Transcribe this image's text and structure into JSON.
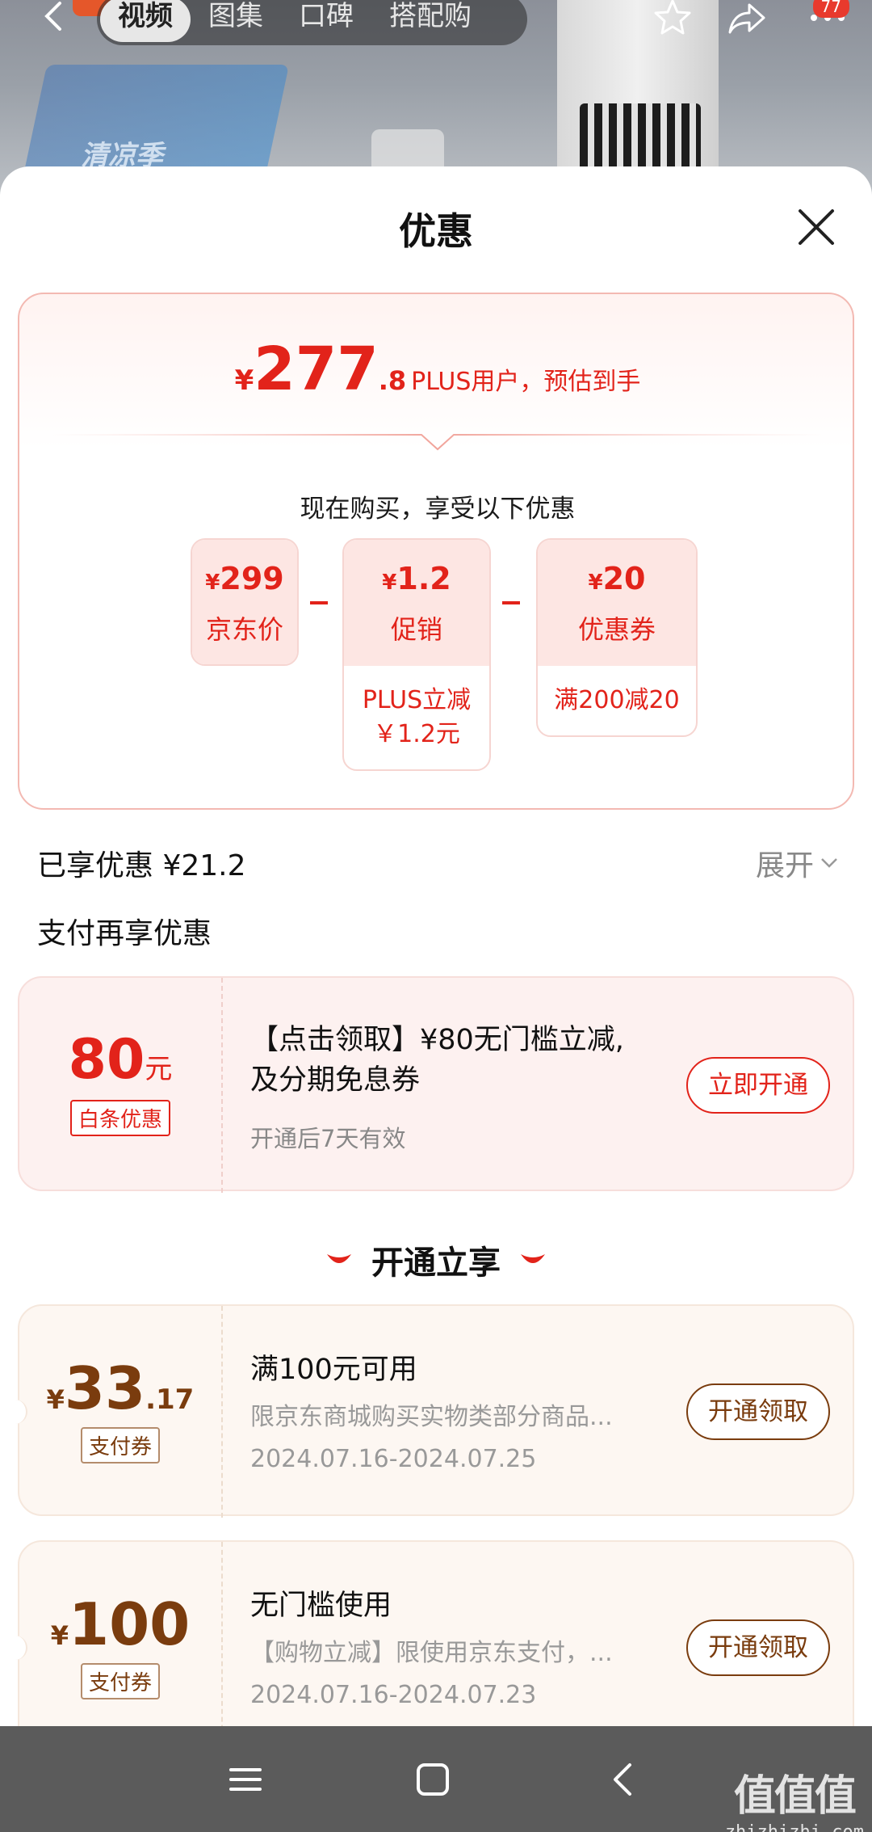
{
  "top_nav": {
    "tabs": [
      "视频",
      "图集",
      "口碑",
      "搭配购"
    ],
    "active_tab_index": 0,
    "icons": [
      "back-icon",
      "star-icon",
      "share-icon",
      "more-icon"
    ],
    "badge": "77"
  },
  "background": {
    "banner_text": "清凉季"
  },
  "sheet": {
    "title": "优惠"
  },
  "estimate": {
    "yen": "¥",
    "price_int": "277",
    "price_dec": ".8",
    "note": "PLUS用户，预估到手",
    "subtitle": "现在购买，享受以下优惠",
    "items": [
      {
        "value_yen": "¥",
        "value": "299",
        "label": "京东价",
        "detail": ""
      },
      {
        "value_yen": "¥",
        "value": "1.2",
        "label": "促销",
        "detail": "PLUS立减￥1.2元"
      },
      {
        "value_yen": "¥",
        "value": "20",
        "label": "优惠券",
        "detail": "满200减20"
      }
    ]
  },
  "enjoyed": {
    "label": "已享优惠 ¥21.2",
    "expand": "展开"
  },
  "payment": {
    "section_title": "支付再享优惠",
    "baitiao": {
      "amount": "80",
      "unit": "元",
      "tag": "白条优惠",
      "title": "【点击领取】¥80无门槛立减,及分期免息券",
      "validity": "开通后7天有效",
      "button": "立即开通"
    }
  },
  "open_section": {
    "title": "开通立享",
    "coupons": [
      {
        "yen": "¥",
        "int": "33",
        "dec": ".17",
        "tag": "支付券",
        "title": "满100元可用",
        "desc": "限京东商城购买实物类部分商品...",
        "date": "2024.07.16-2024.07.25",
        "button": "开通领取"
      },
      {
        "yen": "¥",
        "int": "100",
        "dec": "",
        "tag": "支付券",
        "title": "无门槛使用",
        "desc": "【购物立减】限使用京东支付，...",
        "date": "2024.07.16-2024.07.23",
        "button": "开通领取"
      }
    ]
  },
  "system_nav": {
    "icons": [
      "menu-icon",
      "home-icon",
      "back-icon"
    ]
  },
  "watermark": {
    "main": "值值值",
    "sub": "zhizhizhi.com"
  },
  "colors": {
    "accent_red": "#e2231a",
    "coupon_brown": "#7a3c0e",
    "nav_bar": "#5b5b5b"
  }
}
